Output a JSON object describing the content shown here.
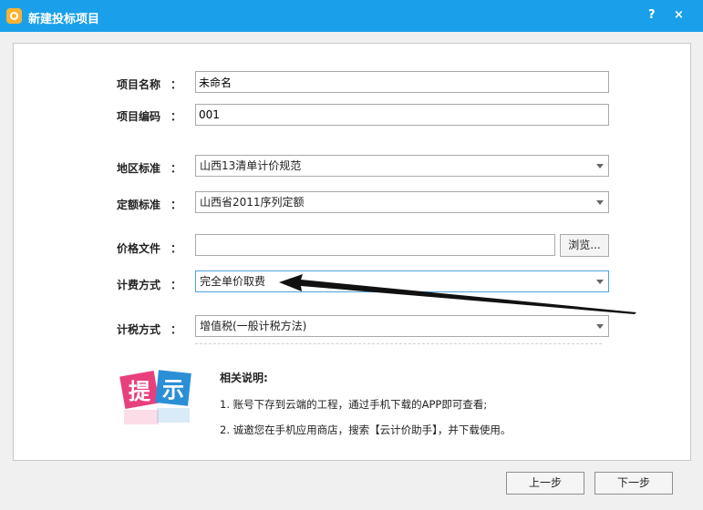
{
  "window": {
    "title": "新建投标项目",
    "help": "?",
    "close": "×"
  },
  "form": {
    "project_name": {
      "label": "项目名称",
      "value": "未命名"
    },
    "project_code": {
      "label": "项目编码",
      "value": "001"
    },
    "region_std": {
      "label": "地区标准",
      "value": "山西13清单计价规范"
    },
    "quota_std": {
      "label": "定额标准",
      "value": "山西省2011序列定额"
    },
    "price_file": {
      "label": "价格文件",
      "value": "",
      "browse_label": "浏览..."
    },
    "billing": {
      "label": "计费方式",
      "value": "完全单价取费"
    },
    "tax": {
      "label": "计税方式",
      "value": "增值税(一般计税方法)"
    },
    "colon": "："
  },
  "tip": {
    "char1": "提",
    "char2": "示"
  },
  "notes": {
    "title": "相关说明:",
    "items": [
      "1. 账号下存到云端的工程，通过手机下载的APP即可查看;",
      "2. 诚邀您在手机应用商店，搜索【云计价助手】，并下载使用。"
    ]
  },
  "buttons": {
    "prev": "上一步",
    "next": "下一步"
  },
  "colors": {
    "titlebar": "#1aa0ea",
    "tip_pink": "#e8407d",
    "tip_blue": "#2b8fd6"
  }
}
